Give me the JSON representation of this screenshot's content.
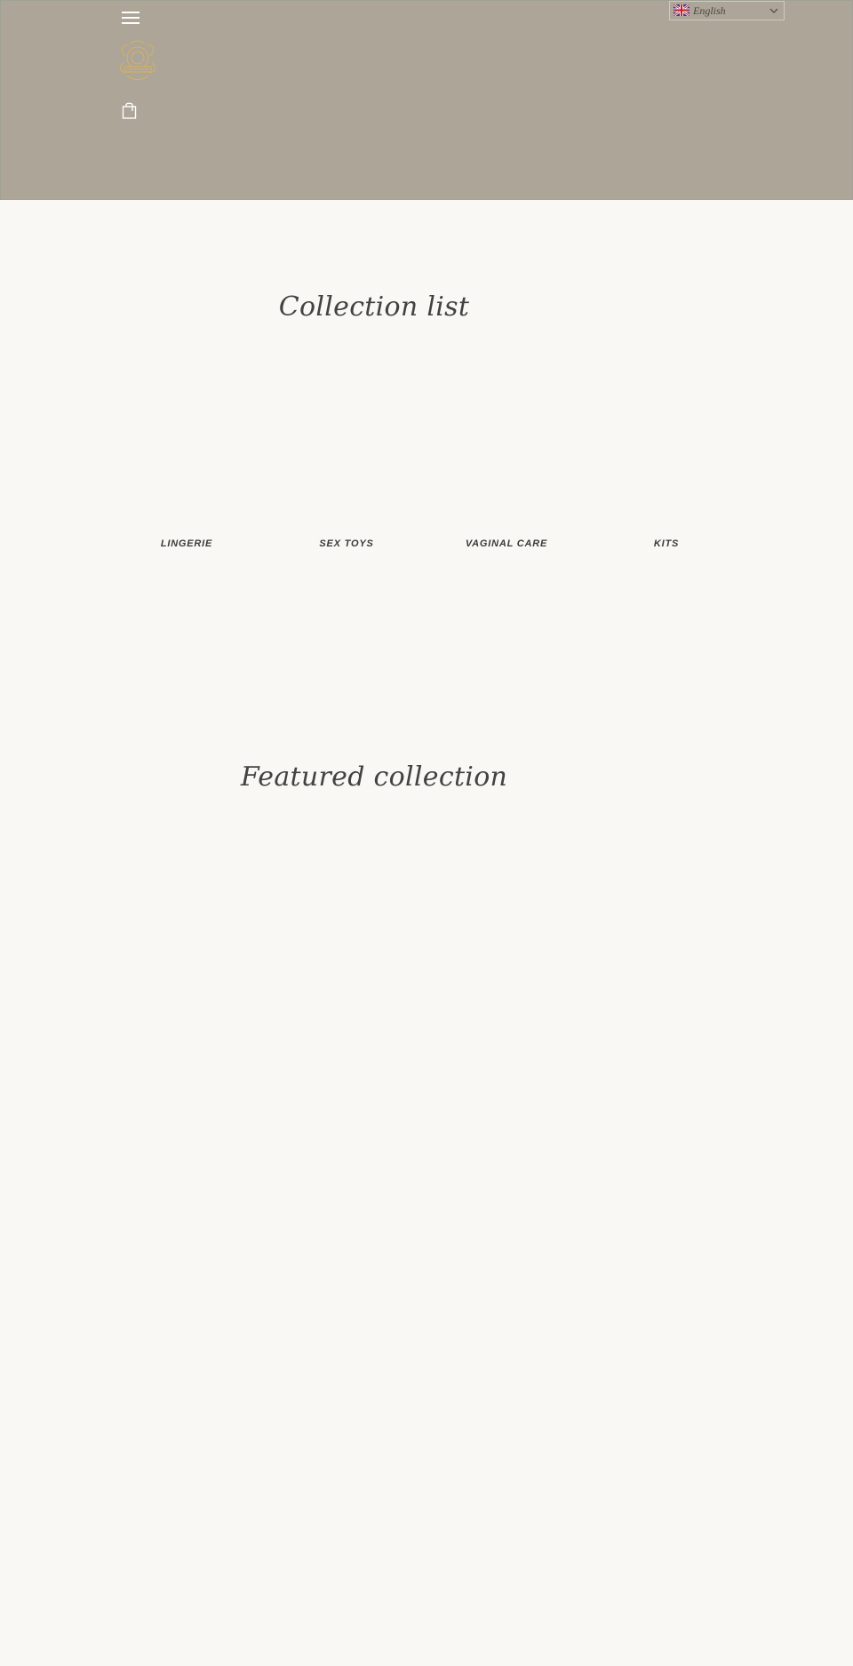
{
  "header": {
    "menu_icon": "hamburger-menu-icon",
    "logo_icon": "gold-crest-logo",
    "cart_icon": "shopping-bag-icon",
    "background_color": "#aca598"
  },
  "language": {
    "selected": "English",
    "flag_icon": "uk-flag-icon",
    "chevron_icon": "chevron-down-icon"
  },
  "collections": {
    "title": "Collection list",
    "items": [
      {
        "label": "LINGERIE"
      },
      {
        "label": "SEX TOYS"
      },
      {
        "label": "VAGINAL CARE"
      },
      {
        "label": "KITS"
      }
    ]
  },
  "featured": {
    "title": "Featured collection"
  },
  "colors": {
    "page_background": "#f9f8f5",
    "heading_text": "#424242",
    "logo_gold": "#d9b25a"
  }
}
